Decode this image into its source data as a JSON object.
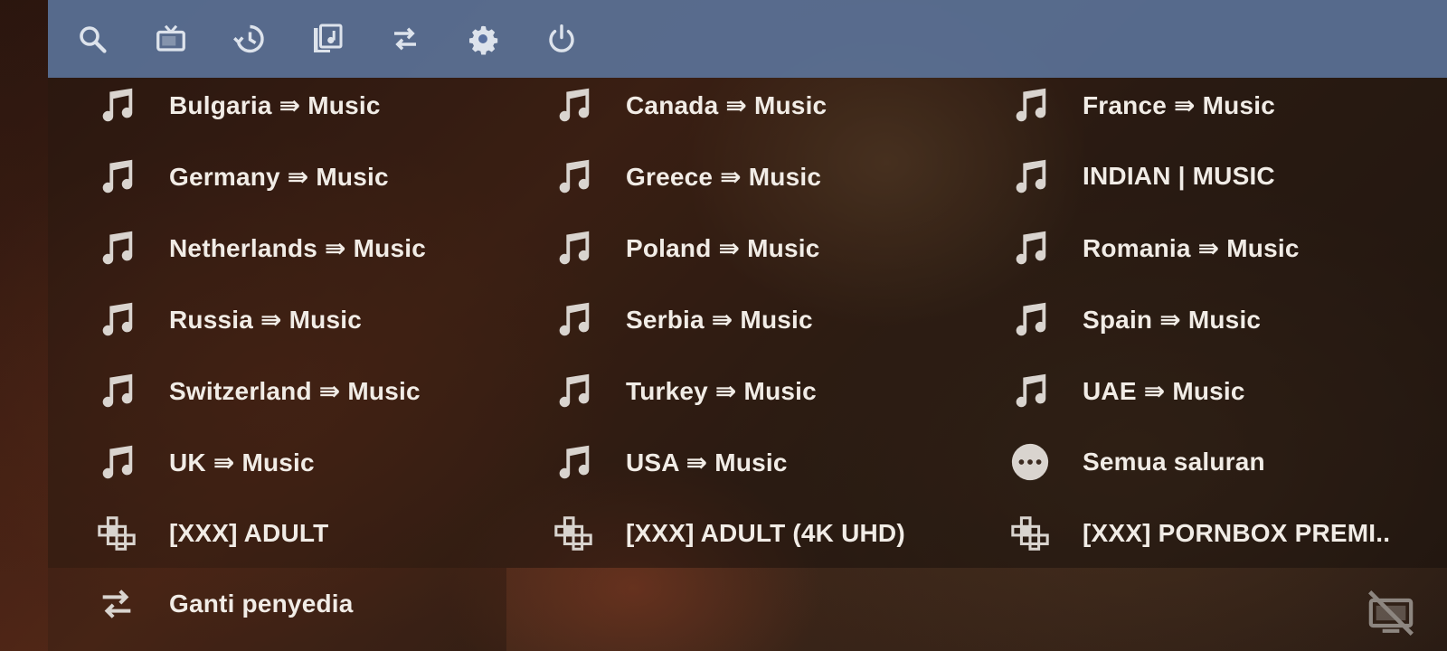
{
  "toolbar": {
    "icons": [
      "search-icon",
      "tv-icon",
      "history-icon",
      "video-library-icon",
      "swap-icon",
      "settings-icon",
      "power-icon"
    ]
  },
  "grid": {
    "items": [
      {
        "label": "Bulgaria ⇛ Music",
        "icon": "music-note-icon"
      },
      {
        "label": "Canada ⇛ Music",
        "icon": "music-note-icon"
      },
      {
        "label": "France ⇛ Music",
        "icon": "music-note-icon"
      },
      {
        "label": "Germany ⇛ Music",
        "icon": "music-note-icon"
      },
      {
        "label": "Greece ⇛ Music",
        "icon": "music-note-icon"
      },
      {
        "label": "INDIAN | MUSIC",
        "icon": "music-note-icon"
      },
      {
        "label": "Netherlands ⇛ Music",
        "icon": "music-note-icon"
      },
      {
        "label": "Poland ⇛ Music",
        "icon": "music-note-icon"
      },
      {
        "label": "Romania ⇛ Music",
        "icon": "music-note-icon"
      },
      {
        "label": "Russia ⇛ Music",
        "icon": "music-note-icon"
      },
      {
        "label": "Serbia ⇛ Music",
        "icon": "music-note-icon"
      },
      {
        "label": "Spain ⇛ Music",
        "icon": "music-note-icon"
      },
      {
        "label": "Switzerland ⇛ Music",
        "icon": "music-note-icon"
      },
      {
        "label": "Turkey ⇛ Music",
        "icon": "music-note-icon"
      },
      {
        "label": "UAE ⇛ Music",
        "icon": "music-note-icon"
      },
      {
        "label": "UK ⇛ Music",
        "icon": "music-note-icon"
      },
      {
        "label": "USA ⇛ Music",
        "icon": "music-note-icon"
      },
      {
        "label": "Semua saluran",
        "icon": "more-horizontal-icon"
      },
      {
        "label": "[XXX] ADULT",
        "icon": "category-blocks-icon"
      },
      {
        "label": "[XXX] ADULT (4K UHD)",
        "icon": "category-blocks-icon"
      },
      {
        "label": "[XXX] PORNBOX PREMI..",
        "icon": "category-blocks-icon"
      }
    ]
  },
  "switch_provider": {
    "label": "Ganti penyedia",
    "icon": "swap-icon"
  },
  "status": {
    "icon": "tv-off-icon"
  },
  "colors": {
    "topbar": "#5870a0",
    "icon": "#dad6d2",
    "text": "#f1ece6"
  }
}
